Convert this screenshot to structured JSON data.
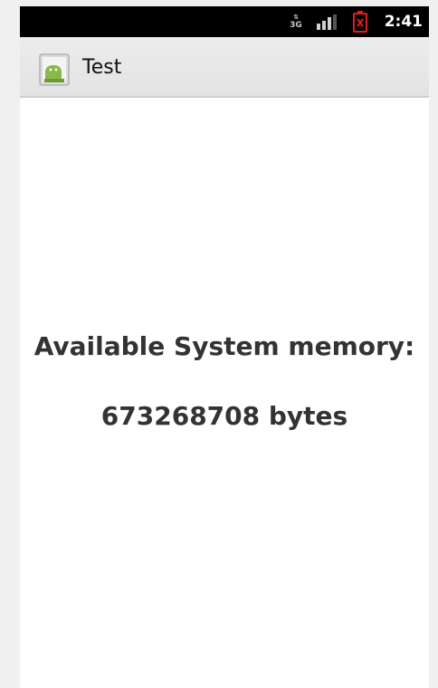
{
  "status_bar": {
    "network_type": "3G",
    "time": "2:41",
    "icons": [
      "network-3g-icon",
      "signal-strength-icon",
      "battery-empty-icon"
    ],
    "battery_alert_color": "#e01e1e"
  },
  "action_bar": {
    "app_icon": "android-app-icon",
    "title": "Test"
  },
  "main": {
    "memory_label": "Available System memory:",
    "memory_value": "673268708 bytes"
  },
  "colors": {
    "status_bar_bg": "#000000",
    "action_bar_bg": "#e8e8e8",
    "content_bg": "#ffffff",
    "text": "#333333"
  }
}
